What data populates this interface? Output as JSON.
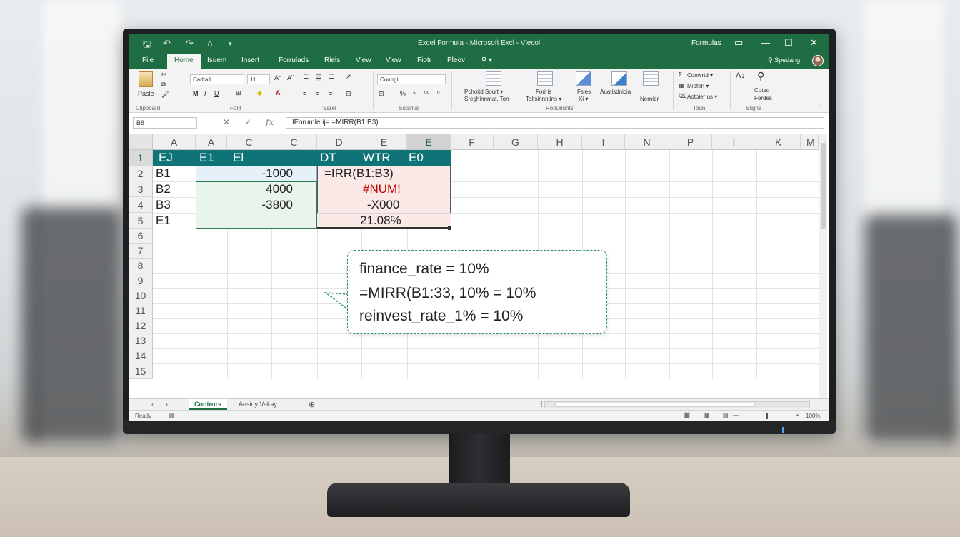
{
  "titlebar": {
    "quick_access": [
      "🖫",
      "↶",
      "↷",
      "⌂",
      "▾"
    ],
    "title": "Excel Formula - Microsoft Excl - Vlecol",
    "right_label": "Formulas",
    "window_buttons": [
      "▭",
      "—",
      "☐",
      "✕"
    ]
  },
  "tabs": [
    "File",
    "Home",
    "Isuem",
    "Insert",
    "Forrulads",
    "Riels",
    "View",
    "View",
    "Fiotr",
    "Pleov",
    "⚲ ▾"
  ],
  "active_tab": "Home",
  "share": "⚲ Spedang",
  "ribbon": {
    "groups": [
      "Clipboard",
      "Font",
      "Sarel",
      "Sutsmal",
      "Rooubunts",
      "Toun",
      "Slighs"
    ],
    "paste": "Pasle",
    "font_name": "Cadtail",
    "font_size": "11",
    "number_format": "Conngil",
    "percent": "%",
    "styles_1": "Pchoitd Sourt ▾",
    "styles_2": "Sreghinnmat. Ton",
    "format_table_1": "Foriris",
    "format_table_2": "Taltsinnntins ▾",
    "cell_styles_1": "Fsies",
    "cell_styles_2": "Xi ▾",
    "insert_1": "Auatisdnicia",
    "format_1": "Nernier",
    "autosum": "Conwrtd ▾",
    "fill": "Mioferl ▾",
    "clear": "Aotoier us ▾",
    "sort_1": "Coted",
    "sort_2": "Fordes"
  },
  "formula_bar": {
    "name_box": "B8",
    "cancel": "✕",
    "enter": "✓",
    "fx": "fx",
    "content": "IForumle ij= =MIRR(B1:B3)"
  },
  "columns": [
    "A",
    "A",
    "C",
    "C",
    "D",
    "E",
    "E",
    "F",
    "G",
    "H",
    "I",
    "N",
    "P",
    "I",
    "K",
    "M"
  ],
  "rows": [
    "1",
    "2",
    "3",
    "4",
    "5",
    "6",
    "7",
    "8",
    "9",
    "10",
    "11",
    "12",
    "13",
    "14",
    "15"
  ],
  "header_cells": [
    "EJ",
    "E1",
    "El",
    "DT",
    "WTR",
    "E0"
  ],
  "cells": {
    "a2": "B1",
    "a3": "B2",
    "a4": "B3",
    "a5": "E1",
    "c2": "-1000",
    "c3": "4000",
    "c4": "-3800",
    "e2": "=IRR(B1:B3)",
    "e3": "#NUM!",
    "e4": "-X000",
    "e5": "21.08%"
  },
  "callout": {
    "line1": "finance_rate = 10%",
    "line2": "=MIRR(B1:33, 10% = 10%",
    "line3": "reinvest_rate_1% = 10%"
  },
  "sheet_tabs": [
    "Contrors",
    "Aesiny Vakay"
  ],
  "add_sheet": "⊕",
  "status": {
    "ready": "Ready",
    "zoom": "100%"
  },
  "colors": {
    "excel_green": "#1f6e43",
    "header_teal": "#0e7478",
    "error_red": "#c00000",
    "callout_border": "#2a8a7b"
  }
}
